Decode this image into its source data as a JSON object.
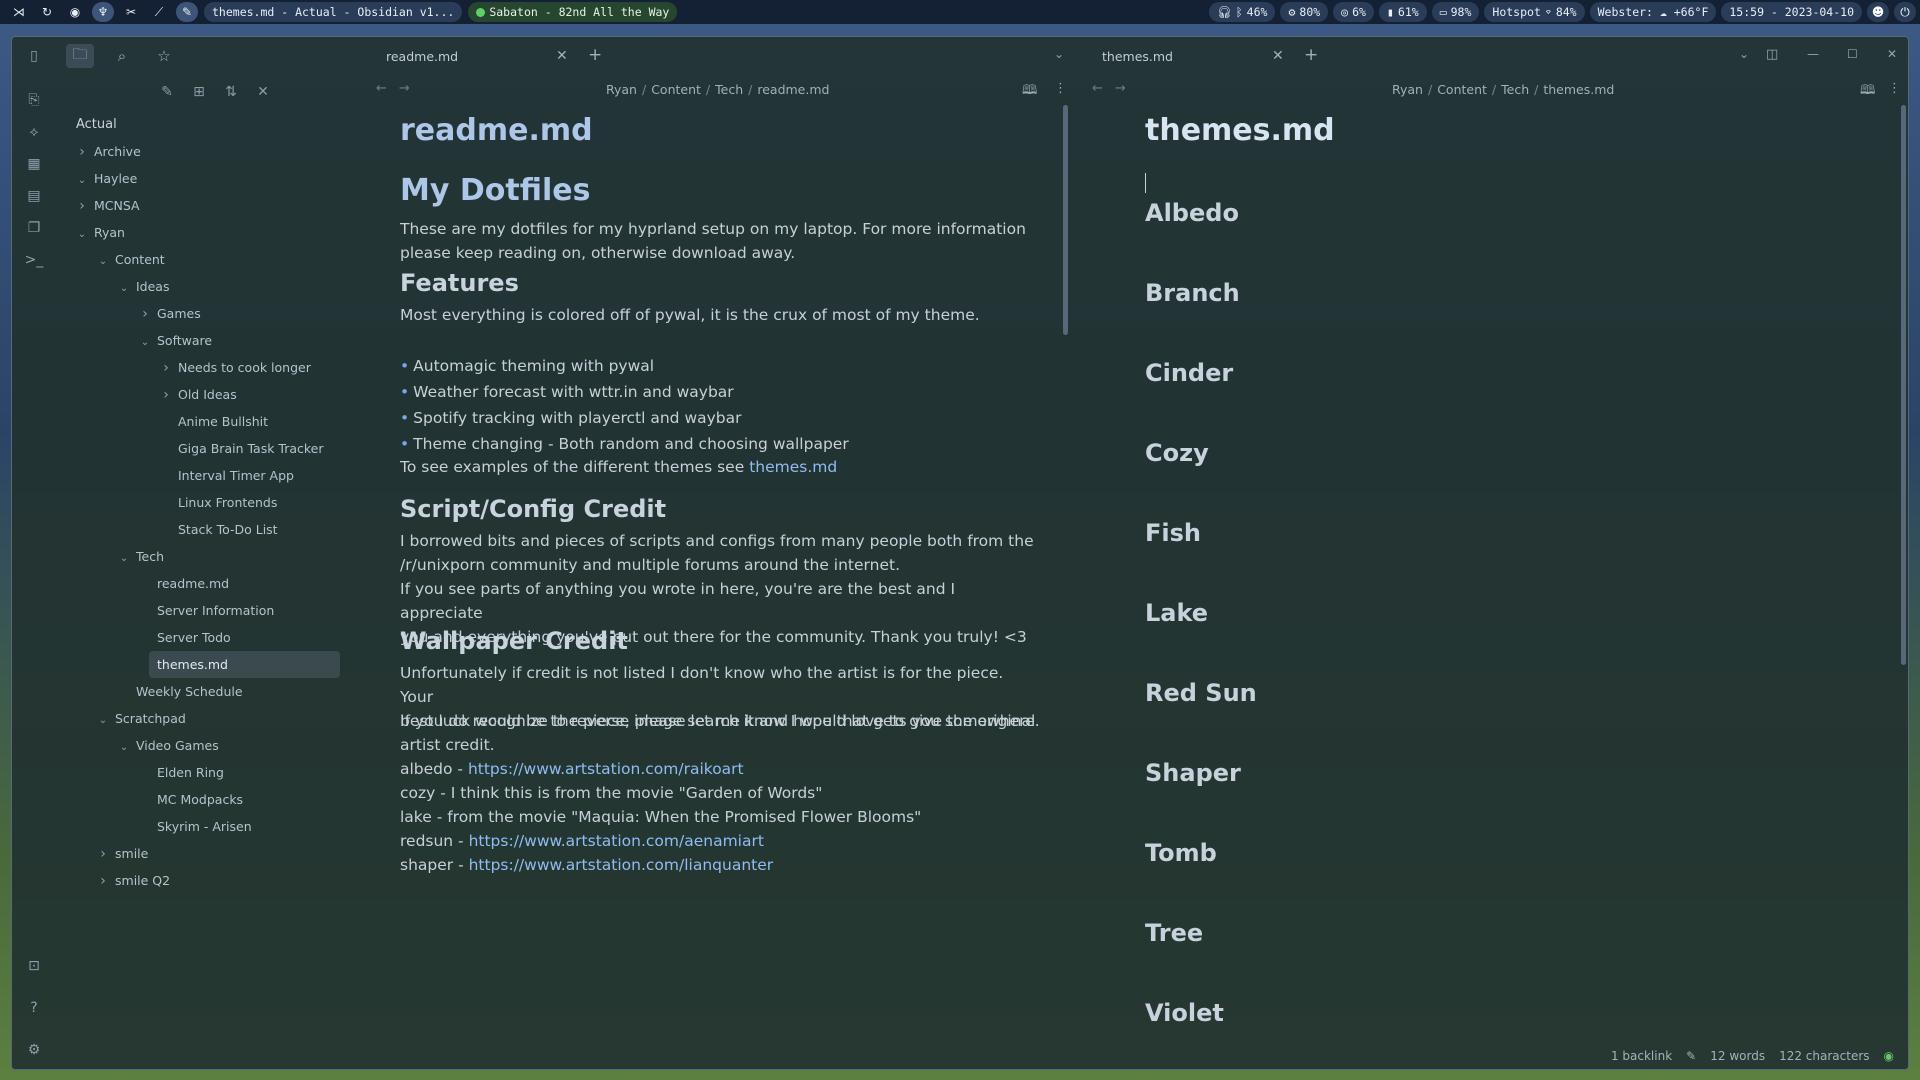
{
  "topbar": {
    "window_title": "themes.md - Actual - Obsidian v1...",
    "music": "Sabaton - 82nd All the Way",
    "headphones": "46%",
    "cpu": "80%",
    "gpu": "6%",
    "memory": "61%",
    "battery": "98%",
    "network": "Hotspot",
    "wifi": "84%",
    "weather": "Webster: ☁ +66°F",
    "clock": "15:59 - 2023-04-10"
  },
  "sidebar": {
    "vault": "Actual",
    "tree": [
      {
        "label": "Archive",
        "depth": 0,
        "folder": true,
        "open": false
      },
      {
        "label": "Haylee",
        "depth": 0,
        "folder": true,
        "open": true
      },
      {
        "label": "MCNSA",
        "depth": 0,
        "folder": true,
        "open": false
      },
      {
        "label": "Ryan",
        "depth": 0,
        "folder": true,
        "open": true
      },
      {
        "label": "Content",
        "depth": 1,
        "folder": true,
        "open": true
      },
      {
        "label": "Ideas",
        "depth": 2,
        "folder": true,
        "open": true
      },
      {
        "label": "Games",
        "depth": 3,
        "folder": true,
        "open": false
      },
      {
        "label": "Software",
        "depth": 3,
        "folder": true,
        "open": true
      },
      {
        "label": "Needs to cook longer",
        "depth": 4,
        "folder": true,
        "open": false
      },
      {
        "label": "Old Ideas",
        "depth": 4,
        "folder": true,
        "open": false
      },
      {
        "label": "Anime Bullshit",
        "depth": 4,
        "folder": false
      },
      {
        "label": "Giga Brain Task Tracker",
        "depth": 4,
        "folder": false
      },
      {
        "label": "Interval Timer App",
        "depth": 4,
        "folder": false
      },
      {
        "label": "Linux Frontends",
        "depth": 4,
        "folder": false
      },
      {
        "label": "Stack To-Do List",
        "depth": 4,
        "folder": false
      },
      {
        "label": "Tech",
        "depth": 2,
        "folder": true,
        "open": true
      },
      {
        "label": "readme.md",
        "depth": 3,
        "folder": false
      },
      {
        "label": "Server Information",
        "depth": 3,
        "folder": false
      },
      {
        "label": "Server Todo",
        "depth": 3,
        "folder": false
      },
      {
        "label": "themes.md",
        "depth": 3,
        "folder": false,
        "selected": true
      },
      {
        "label": "Weekly Schedule",
        "depth": 2,
        "folder": false
      },
      {
        "label": "Scratchpad",
        "depth": 1,
        "folder": true,
        "open": true
      },
      {
        "label": "Video Games",
        "depth": 2,
        "folder": true,
        "open": true
      },
      {
        "label": "Elden Ring",
        "depth": 3,
        "folder": false
      },
      {
        "label": "MC Modpacks",
        "depth": 3,
        "folder": false
      },
      {
        "label": "Skyrim - Arisen",
        "depth": 3,
        "folder": false
      },
      {
        "label": "smile",
        "depth": 1,
        "folder": true,
        "open": false
      },
      {
        "label": "smile Q2",
        "depth": 1,
        "folder": true,
        "open": false
      }
    ]
  },
  "left_pane": {
    "tab": "readme.md",
    "crumbs": [
      "Ryan",
      "Content",
      "Tech",
      "readme.md"
    ],
    "inline_title": "readme.md",
    "h1": "My Dotfiles",
    "intro_1": "These are my dotfiles for my hyprland setup on my laptop. For more information",
    "intro_2": "please keep reading on, otherwise download away.",
    "features_h": "Features",
    "features_p": "Most everything is colored off of pywal, it is the crux of most of my theme.",
    "features_list": [
      "Automagic theming with pywal",
      "Weather forecast with wttr.in and waybar",
      "Spotify tracking with playerctl and waybar",
      "Theme changing - Both random and choosing wallpaper"
    ],
    "see_text": "To see examples of the different themes see ",
    "see_link": "themes.md",
    "credit_h": "Script/Config Credit",
    "credit_1": "I borrowed bits and pieces of scripts and configs from many people both from the",
    "credit_2": "/r/unixporn community and multiple forums around the internet.",
    "credit_3": "If you see parts of anything you wrote in here, you're are the best and I appreciate",
    "credit_4": "you and everything you've put out there for the community. Thank you truly! <3",
    "wall_h": "Wallpaper Credit",
    "wall_1": "Unfortunately if credit is not listed I don't know who the artist is for the piece. Your",
    "wall_2": "best luck would be to reverse image search it and hope that gets you somewhere.",
    "wall_3": "If you do recognize the piece, please let me know I would love to give the original",
    "wall_4": "artist credit.",
    "credits": [
      {
        "prefix": "albedo - ",
        "link": "https://www.artstation.com/raikoart",
        "text": ""
      },
      {
        "prefix": "cozy - I think this is from the movie \"Garden of Words\"",
        "link": "",
        "text": ""
      },
      {
        "prefix": "lake - from the movie \"Maquia: When the Promised Flower Blooms\"",
        "link": "",
        "text": ""
      },
      {
        "prefix": "redsun - ",
        "link": "https://www.artstation.com/aenamiart",
        "text": ""
      },
      {
        "prefix": "shaper - ",
        "link": "https://www.artstation.com/lianquanter",
        "text": ""
      }
    ]
  },
  "right_pane": {
    "tab": "themes.md",
    "crumbs": [
      "Ryan",
      "Content",
      "Tech",
      "themes.md"
    ],
    "inline_title": "themes.md",
    "themes": [
      "Albedo",
      "Branch",
      "Cinder",
      "Cozy",
      "Fish",
      "Lake",
      "Red Sun",
      "Shaper",
      "Tomb",
      "Tree",
      "Violet"
    ]
  },
  "status": {
    "backlinks": "1 backlink",
    "words": "12 words",
    "chars": "122 characters"
  }
}
